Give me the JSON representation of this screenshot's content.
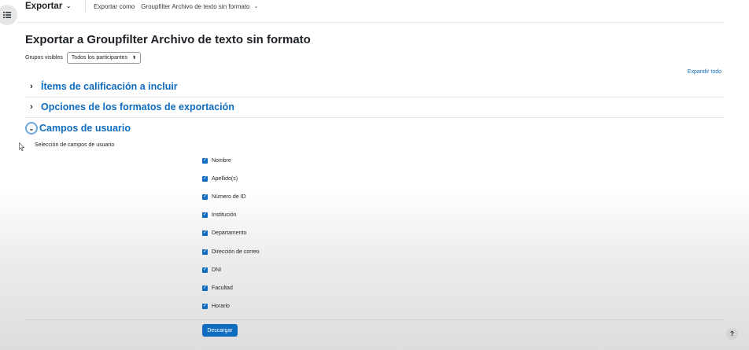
{
  "nav": {
    "main_select": "Exportar",
    "export_as_label": "Exportar como",
    "format_select": "Groupfilter Archivo de texto sin formato"
  },
  "page_title": "Exportar a Groupfilter Archivo de texto sin formato",
  "groups": {
    "label": "Grupos visibles",
    "selected": "Todos los participantes"
  },
  "expand_all": "Expandir todo",
  "sections": [
    {
      "title": "Ítems de calificación a incluir",
      "expanded": false
    },
    {
      "title": "Opciones de los formatos de exportación",
      "expanded": false
    },
    {
      "title": "Campos de usuario",
      "expanded": true
    }
  ],
  "user_fields": {
    "label": "Selección de campos de usuario",
    "items": [
      {
        "label": "Nombre",
        "checked": true
      },
      {
        "label": "Apellido(s)",
        "checked": true
      },
      {
        "label": "Número de ID",
        "checked": true
      },
      {
        "label": "Institución",
        "checked": true
      },
      {
        "label": "Departamento",
        "checked": true
      },
      {
        "label": "Dirección de correo",
        "checked": true
      },
      {
        "label": "DNI",
        "checked": true
      },
      {
        "label": "Facultad",
        "checked": true
      },
      {
        "label": "Horario",
        "checked": true
      }
    ]
  },
  "download_label": "Descargar",
  "help_label": "?",
  "colors": {
    "accent": "#0f6cbf",
    "text": "#1d2125",
    "focus_ring": "#6ea8e0"
  }
}
